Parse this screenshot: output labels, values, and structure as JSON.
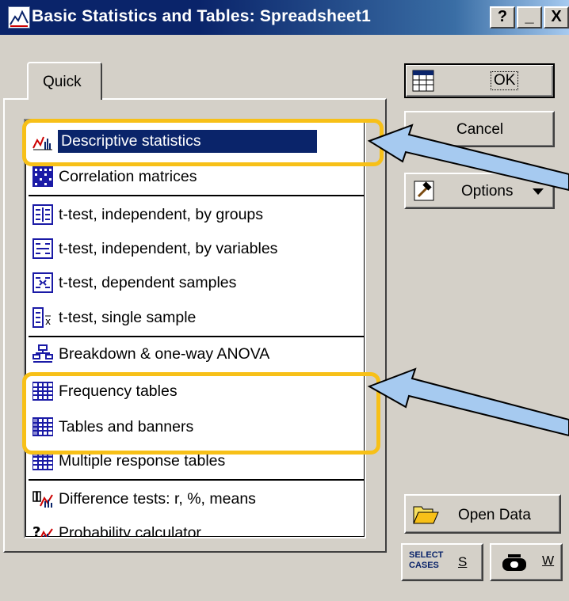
{
  "window": {
    "title": "Basic Statistics and Tables: Spreadsheet1",
    "help_btn": "?",
    "minimize_btn": "_",
    "close_btn": "X"
  },
  "tabs": [
    {
      "label": "Quick"
    }
  ],
  "list": {
    "items": [
      {
        "label": "Descriptive statistics",
        "icon": "descriptive-stats-icon"
      },
      {
        "label": "Correlation matrices",
        "icon": "correlation-matrix-icon"
      },
      {
        "label": "t-test, independent, by groups",
        "icon": "ttest-groups-icon"
      },
      {
        "label": "t-test, independent, by variables",
        "icon": "ttest-variables-icon"
      },
      {
        "label": "t-test, dependent samples",
        "icon": "ttest-dependent-icon"
      },
      {
        "label": "t-test, single sample",
        "icon": "ttest-single-icon"
      },
      {
        "label": "Breakdown & one-way ANOVA",
        "icon": "breakdown-anova-icon"
      },
      {
        "label": "Frequency tables",
        "icon": "frequency-table-icon"
      },
      {
        "label": "Tables and banners",
        "icon": "tables-banners-icon"
      },
      {
        "label": "Multiple response tables",
        "icon": "multiple-response-icon"
      },
      {
        "label": "Difference tests: r, %, means",
        "icon": "difference-tests-icon"
      },
      {
        "label": "Probability calculator",
        "icon": "probability-calc-icon"
      }
    ],
    "selected": "Descriptive statistics"
  },
  "buttons": {
    "ok": "OK",
    "cancel": "Cancel",
    "options": "Options",
    "open_data": "Open Data",
    "select_cases_line1": "SELECT",
    "select_cases_line2": "CASES",
    "select_cases_key": "S",
    "weight_key": "W"
  },
  "colors": {
    "highlight": "#f7c018",
    "arrow": "#a6caf0",
    "selection": "#0a246a",
    "face": "#d4d0c8"
  }
}
